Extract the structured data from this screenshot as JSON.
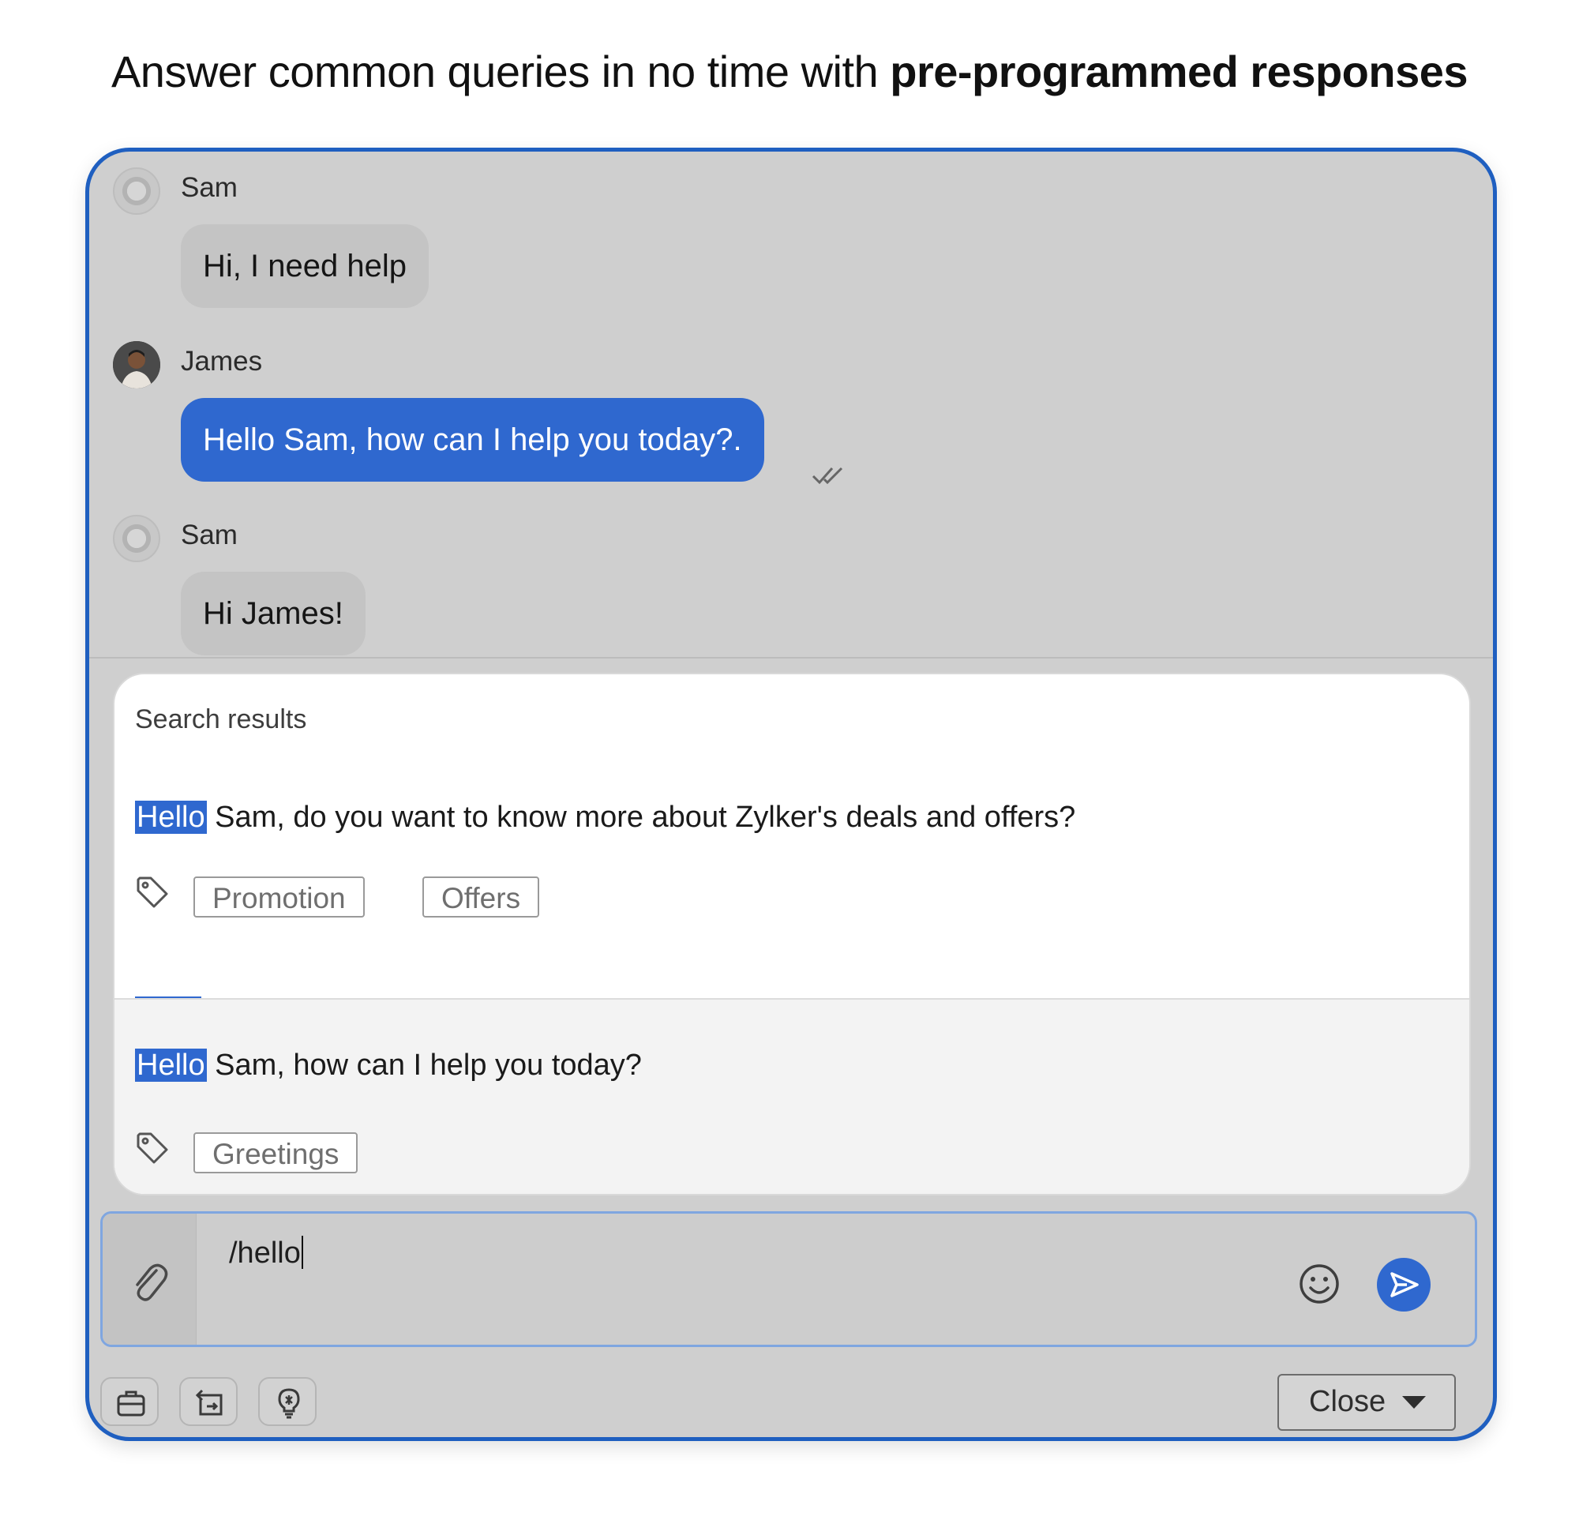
{
  "headline": {
    "regular": "Answer common queries in no time with ",
    "strong": "pre-programmed responses"
  },
  "chat": {
    "messages": [
      {
        "sender": "Sam",
        "text": "Hi, I need help"
      },
      {
        "sender": "James",
        "text": "Hello Sam, how can I help you today?."
      },
      {
        "sender": "Sam",
        "text": "Hi James!"
      }
    ]
  },
  "search_results": {
    "title": "Search results",
    "items": [
      {
        "highlight": "Hello",
        "rest": " Sam, do you want to know more about Zylker's deals and offers?",
        "tags": [
          "Promotion",
          "Offers"
        ]
      },
      {
        "highlight": "Hello",
        "rest": " Sam, how can I help you today?",
        "tags": [
          "Greetings"
        ]
      }
    ]
  },
  "composer": {
    "value": "/hello"
  },
  "footer": {
    "close_label": "Close"
  },
  "colors": {
    "accent": "#2f68cf",
    "window_border": "#1f5fc0"
  },
  "icons": [
    "tag-icon",
    "paperclip-icon",
    "emoji-icon",
    "send-icon",
    "briefcase-icon",
    "transfer-icon",
    "lightbulb-icon",
    "double-check-icon",
    "chevron-down-icon"
  ]
}
